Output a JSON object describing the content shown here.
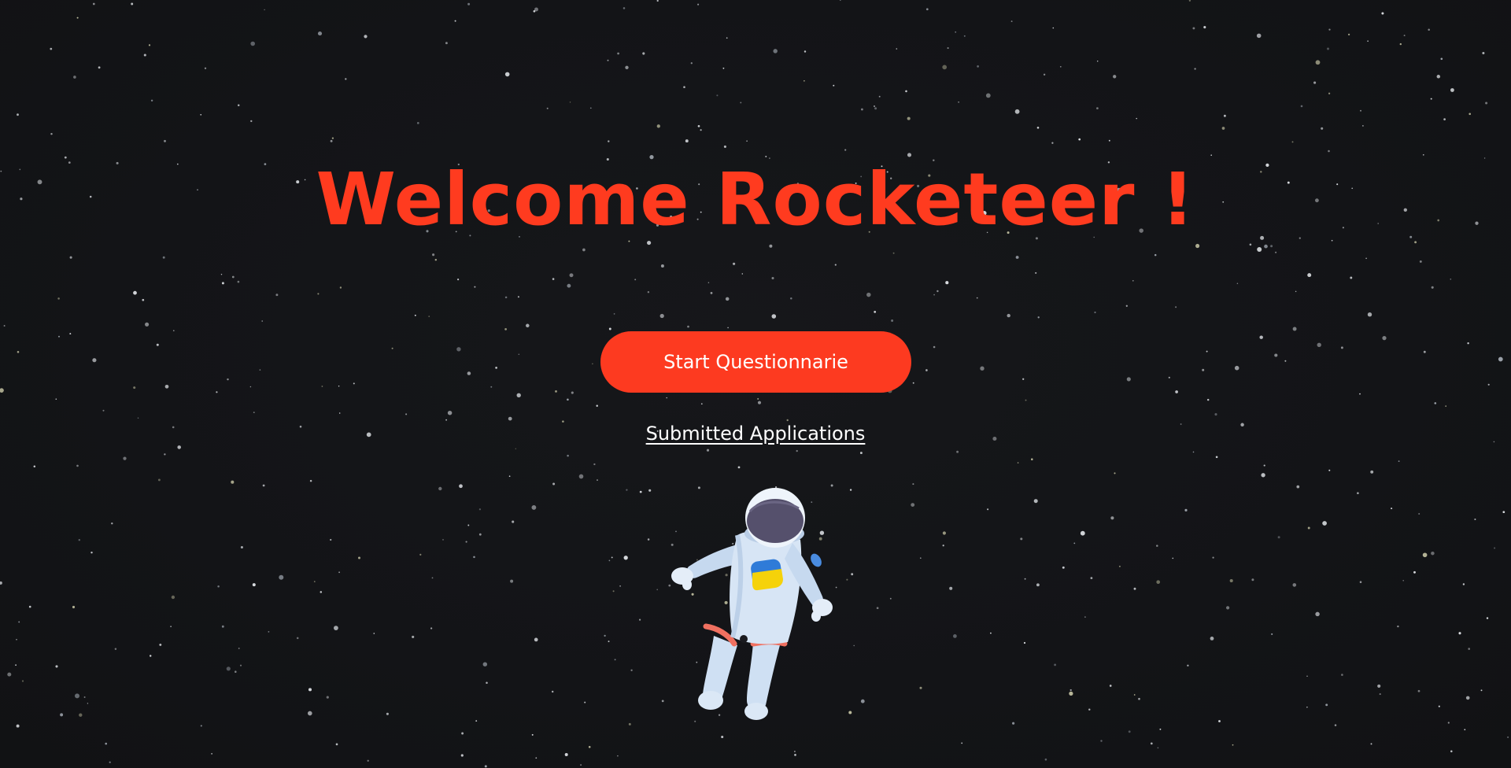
{
  "page": {
    "title": "Welcome Rocketeer !",
    "start_button_label": "Start Questionnarie",
    "submitted_link_label": "Submitted Applications"
  },
  "colors": {
    "background": "#141518",
    "accent": "#fd3a20",
    "title": "#ff3b1f",
    "link": "#ffffff"
  },
  "icons": {
    "hero_illustration": "astronaut-illustration",
    "background": "starfield"
  }
}
